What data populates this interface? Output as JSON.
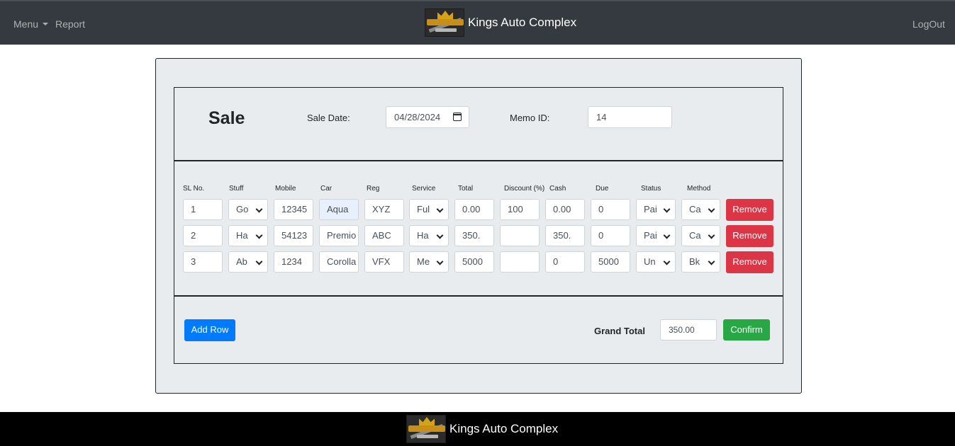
{
  "navbar": {
    "menu_label": "Menu",
    "report_label": "Report",
    "brand_name": "Kings Auto Complex",
    "logout_label": "LogOut"
  },
  "sale": {
    "title": "Sale",
    "date_label": "Sale Date:",
    "date_value": "04/28/2024",
    "memo_label": "Memo ID:",
    "memo_value": "14"
  },
  "table": {
    "headers": [
      "SL No.",
      "Stuff",
      "Mobile",
      "Car",
      "Reg",
      "Service",
      "Total",
      "Discount (%)",
      "Cash",
      "Due",
      "Status",
      "Method"
    ],
    "rows": [
      {
        "sl": "1",
        "stuff": "Go",
        "mobile": "12345",
        "car": "Aqua",
        "reg": "XYZ",
        "service": "Ful",
        "total": "0.00",
        "discount": "100",
        "cash": "0.00",
        "due": "0",
        "status": "Pai",
        "method": "Ca",
        "remove_label": "Remove"
      },
      {
        "sl": "2",
        "stuff": "Ha",
        "mobile": "54123",
        "car": "Premio",
        "reg": "ABC",
        "service": "Ha",
        "total": "350.",
        "discount": "",
        "cash": "350.",
        "due": "0",
        "status": "Pai",
        "method": "Ca",
        "remove_label": "Remove"
      },
      {
        "sl": "3",
        "stuff": "Ab",
        "mobile": "1234",
        "car": "Corolla",
        "reg": "VFX",
        "service": "Me",
        "total": "5000",
        "discount": "",
        "cash": "0",
        "due": "5000",
        "status": "Un",
        "method": "Bk",
        "remove_label": "Remove"
      }
    ]
  },
  "footer_bar": {
    "add_row_label": "Add Row",
    "grand_total_label": "Grand Total",
    "grand_total_value": "350.00",
    "confirm_label": "Confirm"
  },
  "footer": {
    "brand_name": "Kings Auto Complex"
  },
  "colors": {
    "navbar_bg": "#343a40",
    "danger": "#dc3545",
    "primary": "#007bff",
    "success": "#28a745",
    "card_bg": "#e9ecef"
  },
  "icons": [
    "kings-auto-logo",
    "calendar-icon",
    "chevron-down-icon",
    "caret-down-icon"
  ]
}
